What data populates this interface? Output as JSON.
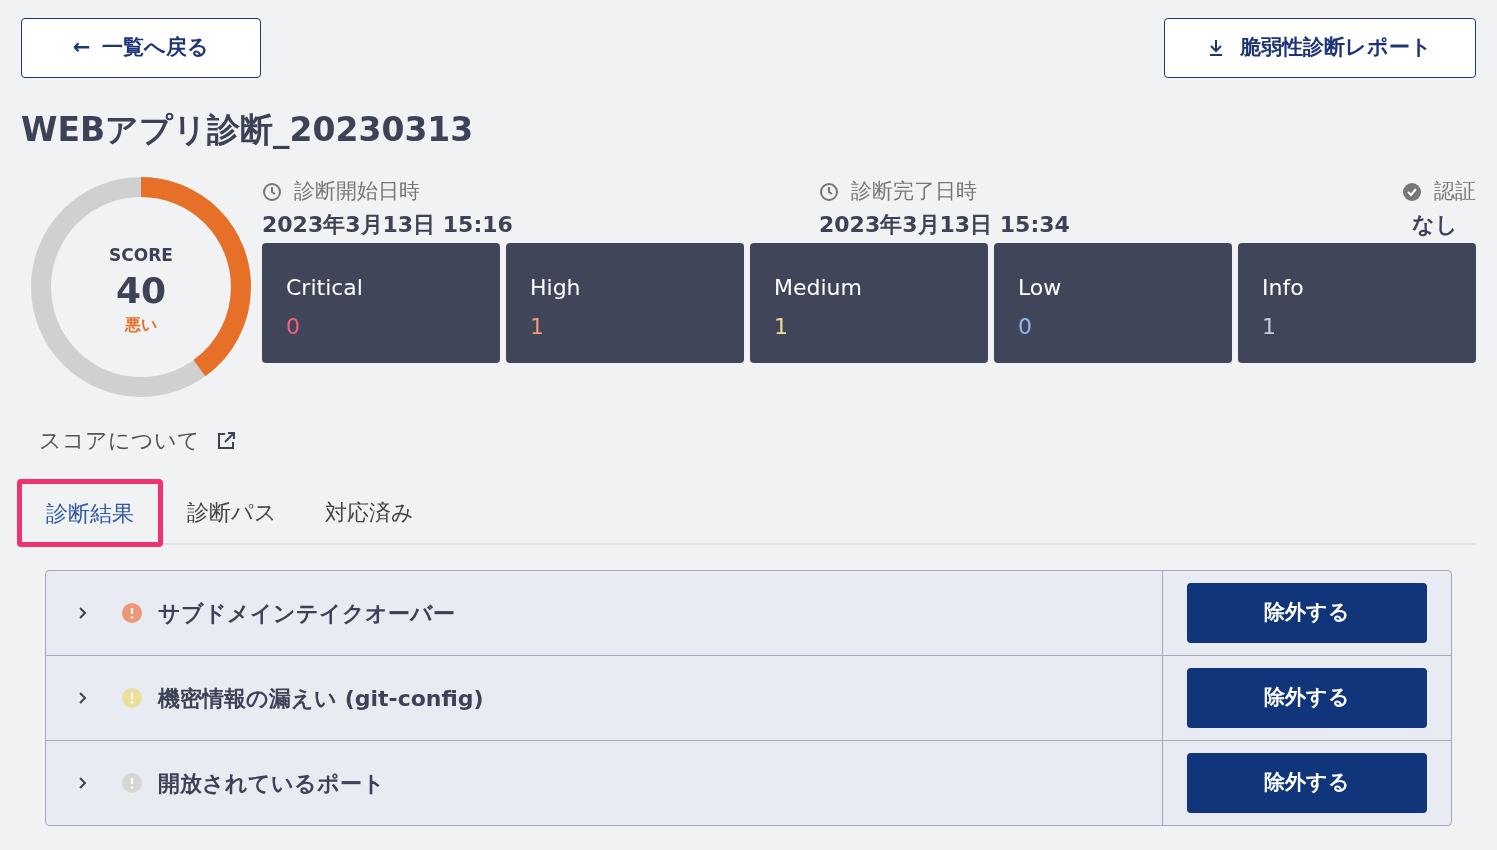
{
  "back_button": {
    "label": "一覧へ戻る",
    "icon": "←"
  },
  "report_button": {
    "label": "脆弱性診断レポート"
  },
  "title": "WEBアプリ診断_20230313",
  "score": {
    "heading": "SCORE",
    "value": "40",
    "rating": "悪い",
    "color": "#e67028"
  },
  "score_link": "スコアについて",
  "meta": [
    {
      "kind": "clock",
      "label": "診断開始日時",
      "value": "2023年3月13日 15:16"
    },
    {
      "kind": "clock",
      "label": "診断完了日時",
      "value": "2023年3月13日 15:34"
    },
    {
      "kind": "check",
      "label": "認証",
      "value": "なし"
    }
  ],
  "severities": [
    {
      "label": "Critical",
      "count": "0",
      "color": "#f0607a"
    },
    {
      "label": "High",
      "count": "1",
      "color": "#f29a7a"
    },
    {
      "label": "Medium",
      "count": "1",
      "color": "#f0dc9a"
    },
    {
      "label": "Low",
      "count": "0",
      "color": "#8fb8f0"
    },
    {
      "label": "Info",
      "count": "1",
      "color": "#c8cbd6"
    }
  ],
  "tabs": [
    {
      "label": "診断結果",
      "selected": true
    },
    {
      "label": "診断パス",
      "selected": false
    },
    {
      "label": "対応済み",
      "selected": false
    }
  ],
  "findings": [
    {
      "title": "サブドメインテイクオーバー",
      "color": "#ee9777",
      "button": "除外する"
    },
    {
      "title": "機密情報の漏えい (git-config)",
      "color": "#ecdf9c",
      "button": "除外する"
    },
    {
      "title": "開放されているポート",
      "color": "#d6d6d6",
      "button": "除外する"
    }
  ]
}
